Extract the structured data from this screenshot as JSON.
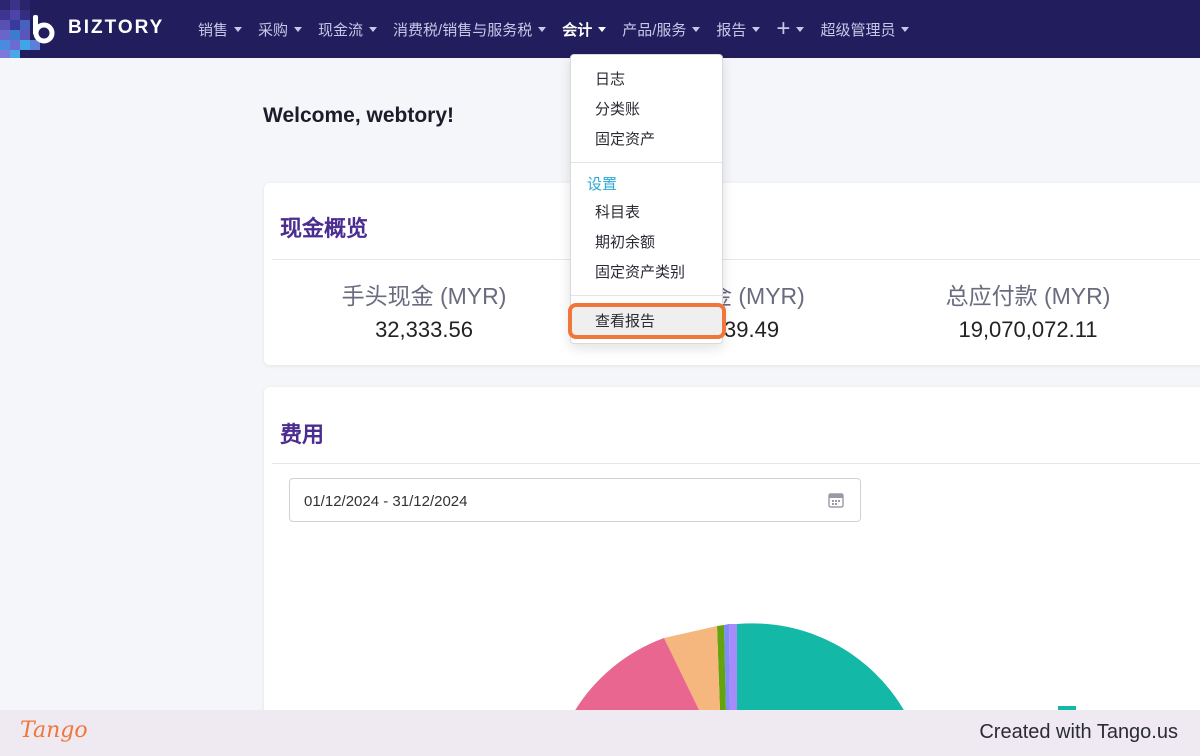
{
  "brand": {
    "name": "BIZTORY",
    "logo_letter": "b"
  },
  "nav": {
    "items": [
      {
        "label": "销售"
      },
      {
        "label": "采购"
      },
      {
        "label": "现金流"
      },
      {
        "label": "消费税/销售与服务税"
      },
      {
        "label": "会计",
        "active": true
      },
      {
        "label": "产品/服务"
      },
      {
        "label": "报告"
      },
      {
        "label": "+"
      },
      {
        "label": "超级管理员"
      }
    ]
  },
  "welcome": "Welcome, webtory!",
  "cash_overview": {
    "title": "现金概览",
    "stats": [
      {
        "label": "手头现金 (MYR)",
        "value": "32,333.56"
      },
      {
        "label": "金 (MYR)",
        "value": "39.49"
      },
      {
        "label": "总应付款 (MYR)",
        "value": "19,070,072.11"
      }
    ]
  },
  "expenses": {
    "title": "费用",
    "date_range": "01/12/2024 - 31/12/2024"
  },
  "dropdown": {
    "items": [
      "日志",
      "分类账",
      "固定资产"
    ],
    "settings_header": "设置",
    "settings_items": [
      "科目表",
      "期初余额",
      "固定资产类别"
    ],
    "report_item": "查看报告"
  },
  "footer": {
    "logo": "Tango",
    "created": "Created with Tango.us"
  },
  "colors": {
    "nav_bg": "#221d5c",
    "accent_title": "#4a2d8f",
    "highlight": "#f0763a",
    "settings_header": "#2da9d6"
  }
}
